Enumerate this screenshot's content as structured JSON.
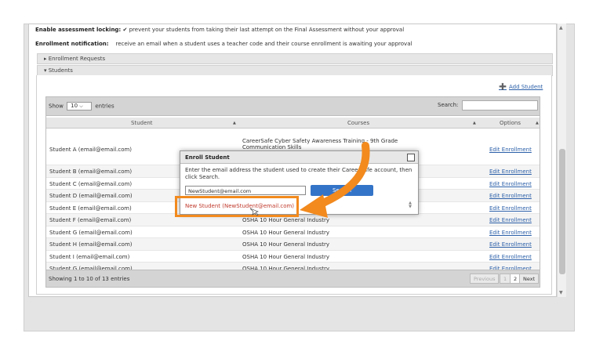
{
  "settings": {
    "locking_label": "Enable assessment locking:",
    "locking_check": "✔",
    "locking_text": "prevent your students from taking their last attempt on the Final Assessment without your approval",
    "notify_label": "Enrollment notification:",
    "notify_text": "receive an email when a student uses a teacher code and their course enrollment is awaiting your approval"
  },
  "sections": {
    "enrollment_requests": "▸ Enrollment Requests",
    "students": "▾ Students"
  },
  "add_student": {
    "icon": "add-user-icon",
    "glyph": "➕",
    "label": "Add Student"
  },
  "table": {
    "show_label": "Show",
    "show_value": "10",
    "show_caret": "⌵",
    "entries_label": "entries",
    "search_label": "Search:",
    "columns": {
      "student": "Student",
      "courses": "Courses",
      "options": "Options",
      "sort_glyph": "▲"
    },
    "rows": [
      {
        "student": "Student A (email@email.com)",
        "courses": "CareerSafe Cyber Safety Awareness Training - 9th Grade\nCommunication Skills\nCommunication Skills",
        "option": "Edit Enrollment"
      },
      {
        "student": "Student B (email@email.com)",
        "courses": "",
        "option": "Edit Enrollment"
      },
      {
        "student": "Student C (email@email.com)",
        "courses": "",
        "option": "Edit Enrollment"
      },
      {
        "student": "Student D (email@email.com)",
        "courses": "",
        "option": "Edit Enrollment"
      },
      {
        "student": "Student E (email@email.com)",
        "courses": "",
        "option": "Edit Enrollment"
      },
      {
        "student": "Student F (email@email.com)",
        "courses": "OSHA 10 Hour General Industry",
        "option": "Edit Enrollment"
      },
      {
        "student": "Student G (email@email.com)",
        "courses": "OSHA 10 Hour General Industry",
        "option": "Edit Enrollment"
      },
      {
        "student": "Student H (email@email.com)",
        "courses": "OSHA 10 Hour General Industry",
        "option": "Edit Enrollment"
      },
      {
        "student": "Student I (email@email.com)",
        "courses": "OSHA 10 Hour General Industry",
        "option": "Edit Enrollment"
      },
      {
        "student": "Student G (email@email.com)",
        "courses": "OSHA 10 Hour General Industry",
        "option": "Edit Enrollment"
      }
    ],
    "footer_info": "Showing 1 to 10 of 13 entries",
    "pagination": {
      "previous": "Previous",
      "page1": "1",
      "page2": "2",
      "next": "Next"
    }
  },
  "dialog": {
    "title": "Enroll Student",
    "instructions": "Enter the email address the student used to create their CareerSafe account, then click Search.",
    "email_value": "NewStudent@email.com",
    "search_label": "Search",
    "result": "New Student (NewStudent@email.com)",
    "spinner": "▲\n▼"
  },
  "colors": {
    "highlight": "#f28a1e",
    "link": "#2b5fa8",
    "result_text": "#c0392b",
    "button": "#3474c8"
  }
}
